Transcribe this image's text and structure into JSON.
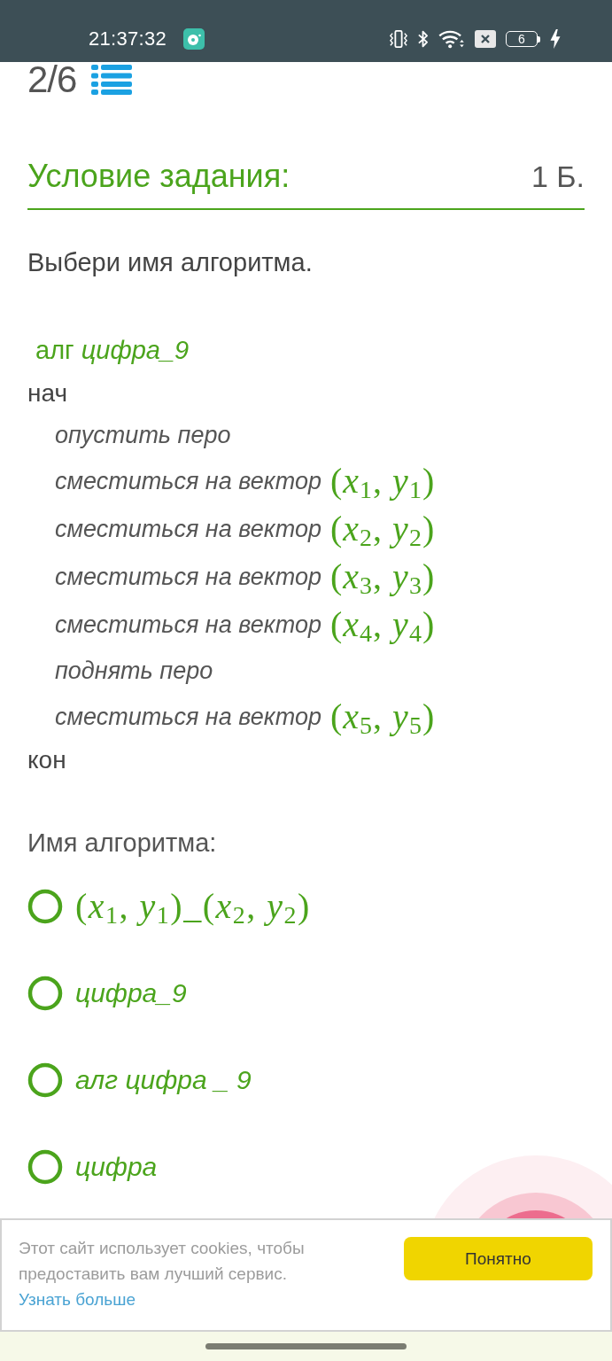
{
  "status_bar": {
    "time": "21:37:32",
    "battery": "6"
  },
  "header": {
    "counter": "2/6"
  },
  "task": {
    "title": "Условие задания:",
    "points": "1 Б.",
    "prompt": "Выбери имя алгоритма."
  },
  "code": [
    {
      "kind": "header",
      "text": "алг *цифра_9*"
    },
    {
      "kind": "keyword",
      "text": "нач"
    },
    {
      "kind": "command",
      "text": "опустить перо"
    },
    {
      "kind": "command",
      "text": "сместиться на вектор",
      "vector": "(*x*$_{1}$, *y*$_{1}$)"
    },
    {
      "kind": "command",
      "text": "сместиться на вектор",
      "vector": "(*x*$_{2}$, *y*$_{2}$)"
    },
    {
      "kind": "command",
      "text": "сместиться на вектор",
      "vector": "(*x*$_{3}$, *y*$_{3}$)"
    },
    {
      "kind": "command",
      "text": "сместиться на вектор",
      "vector": "(*x*$_{4}$, *y*$_{4}$)"
    },
    {
      "kind": "command",
      "text": "поднять перо"
    },
    {
      "kind": "command",
      "text": "сместиться на вектор",
      "vector": "(*x*$_{5}$, *y*$_{5}$)"
    },
    {
      "kind": "keyword",
      "text": "кон"
    }
  ],
  "answer": {
    "label": "Имя алгоритма:",
    "options": [
      {
        "kind": "math",
        "text": "(*x*$_{1}$, *y*$_{1}$)_(*x*$_{2}$, *y*$_{2}$)",
        "selected": false
      },
      {
        "kind": "text",
        "text": "цифра_9",
        "selected": false
      },
      {
        "kind": "text",
        "text": "алг цифра _ 9",
        "selected": false
      },
      {
        "kind": "text",
        "text": "цифра",
        "selected": false
      }
    ]
  },
  "cookie_banner": {
    "message": "Этот сайт использует cookies, чтобы предоставить вам лучший сервис.",
    "link": "Узнать больше",
    "button": "Понятно"
  }
}
